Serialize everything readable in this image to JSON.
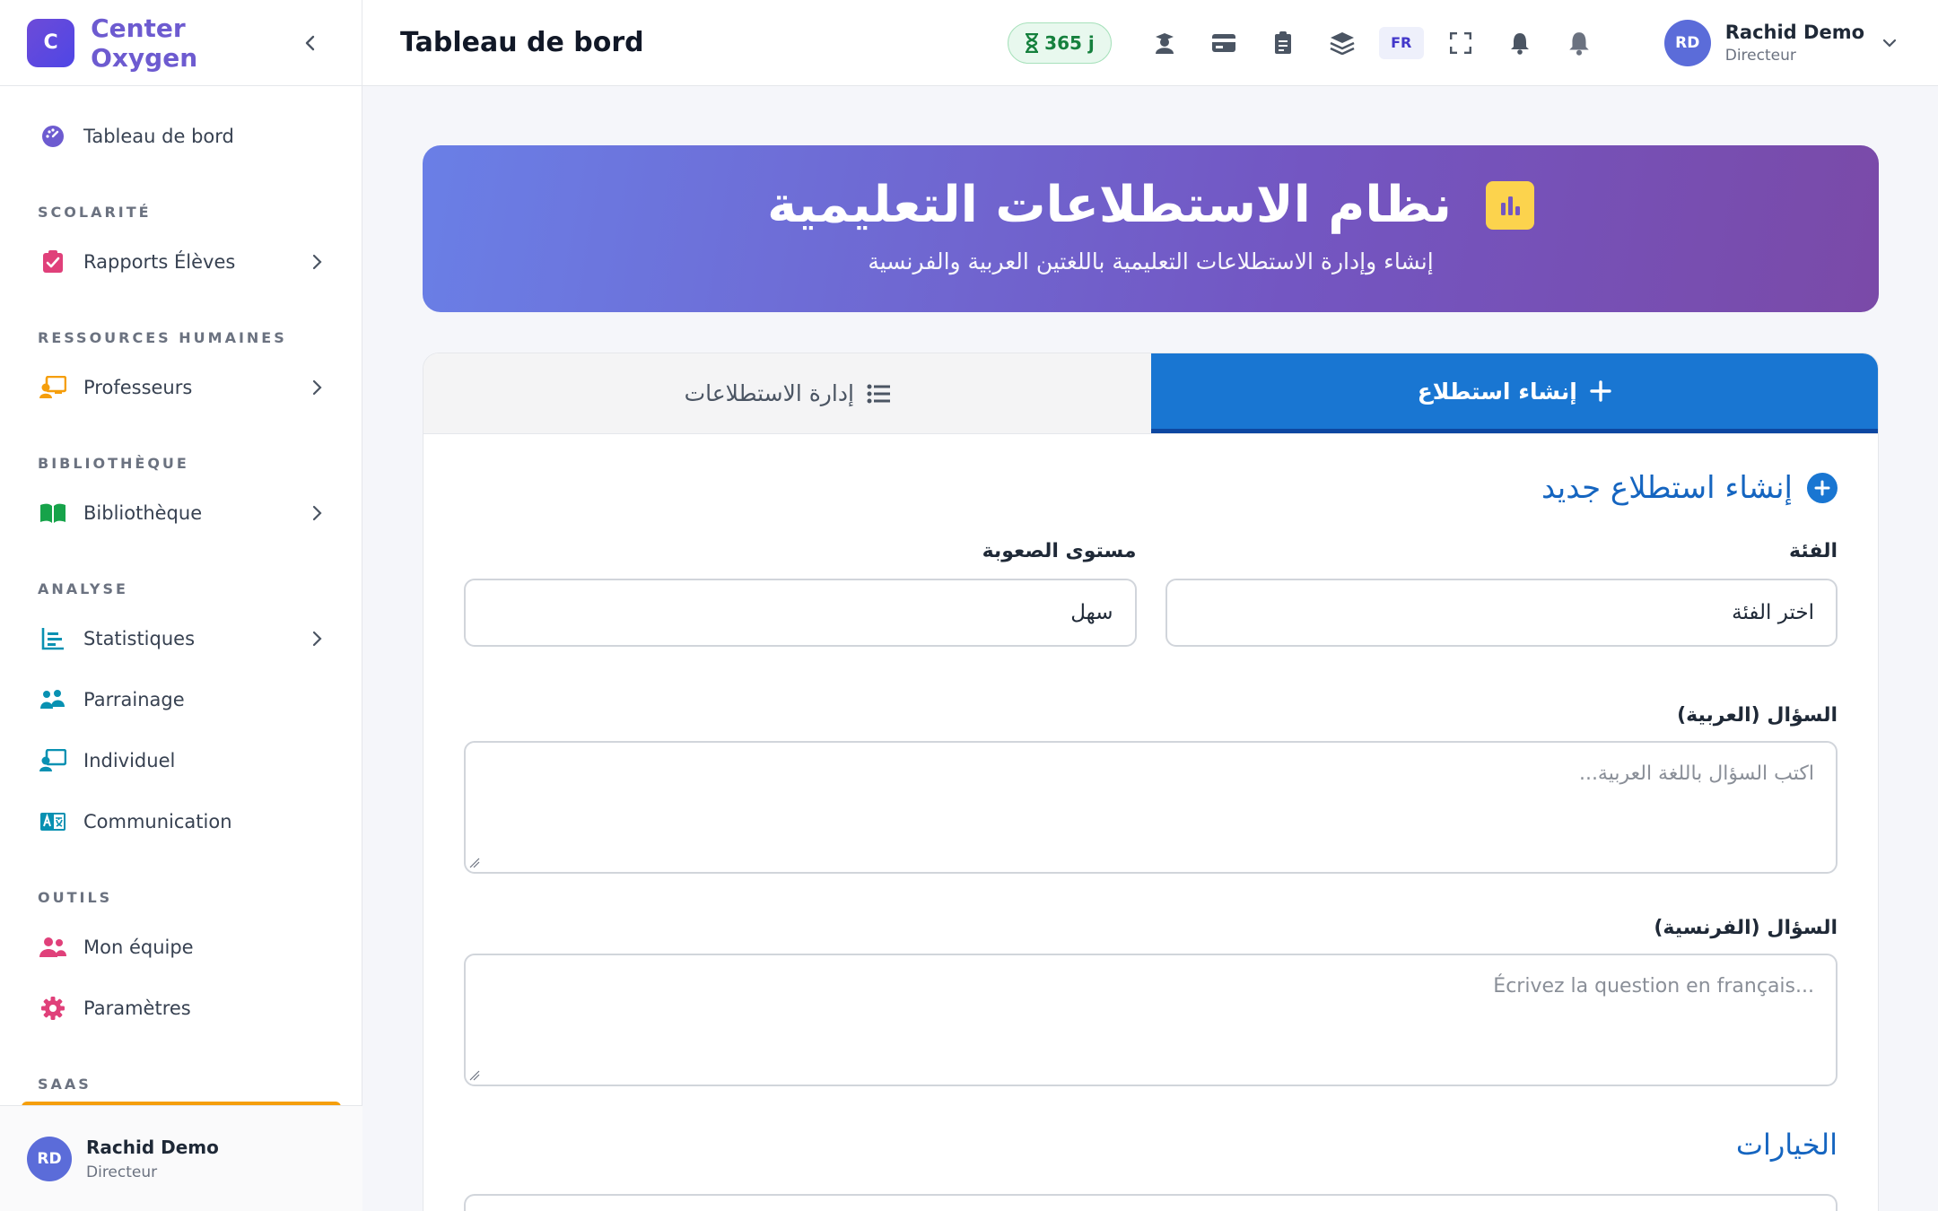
{
  "sidebar": {
    "brand_initial": "C",
    "brand_name": "Center Oxygen",
    "items": {
      "dashboard": "Tableau de bord",
      "rapports": "Rapports Élèves",
      "professeurs": "Professeurs",
      "bibliotheque": "Bibliothèque",
      "statistiques": "Statistiques",
      "parrainage": "Parrainage",
      "individuel": "Individuel",
      "communication": "Communication",
      "equipe": "Mon équipe",
      "parametres": "Paramètres"
    },
    "sections": {
      "scolarite": "SCOLARITÉ",
      "rh": "RESSOURCES HUMAINES",
      "bibliotheque": "BIBLIOTHÈQUE",
      "analyse": "ANALYSE",
      "outils": "OUTILS",
      "saas": "SAAS"
    },
    "user": {
      "initials": "RD",
      "name": "Rachid Demo",
      "role": "Directeur"
    }
  },
  "header": {
    "title": "Tableau de bord",
    "days_badge": "365 j",
    "lang": "FR",
    "user": {
      "initials": "RD",
      "name": "Rachid Demo",
      "role": "Directeur"
    }
  },
  "hero": {
    "title": "نظام الاستطلاعات التعليمية",
    "subtitle": "إنشاء وإدارة الاستطلاعات التعليمية باللغتين العربية والفرنسية"
  },
  "tabs": {
    "create": "إنشاء استطلاع",
    "manage": "إدارة الاستطلاعات"
  },
  "form": {
    "title": "إنشاء استطلاع جديد",
    "category_label": "الفئة",
    "category_value": "اختر الفئة",
    "difficulty_label": "مستوى الصعوبة",
    "difficulty_value": "سهل",
    "question_ar_label": "السؤال (العربية)",
    "question_ar_placeholder": "اكتب السؤال باللغة العربية...",
    "question_fr_label": "السؤال (الفرنسية)",
    "question_fr_placeholder": "...Écrivez la question en français",
    "options_title": "الخيارات"
  },
  "colors": {
    "accent": "#1976d2",
    "brand": "#6d5bd0",
    "badge_green": "#15803d",
    "hero_icon": "#fcd34d"
  }
}
